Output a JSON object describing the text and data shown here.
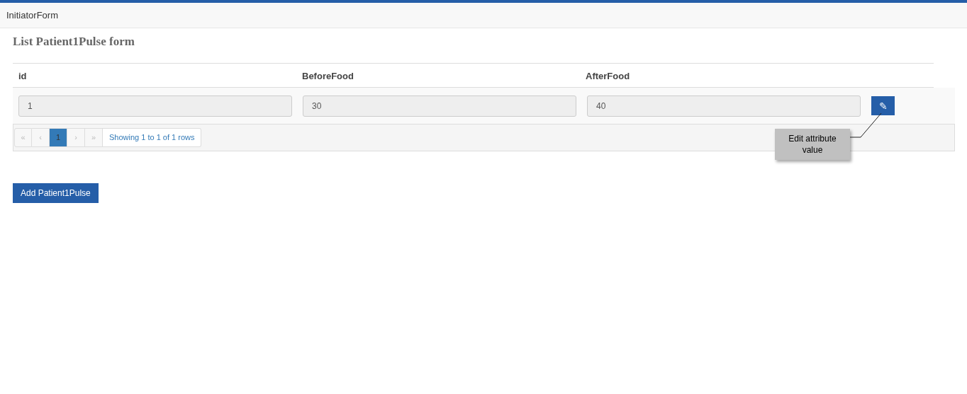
{
  "navbar": {
    "brand": "InitiatorForm"
  },
  "title": "List Patient1Pulse form",
  "table": {
    "columns": [
      "id",
      "BeforeFood",
      "AfterFood"
    ],
    "rows": [
      {
        "cells": [
          {
            "value": "1",
            "disabled": true
          },
          {
            "value": "30",
            "disabled": true
          },
          {
            "value": "40",
            "disabled": true
          }
        ],
        "edit_icon": "✎"
      }
    ]
  },
  "pagination": {
    "items": [
      {
        "label": "«",
        "disabled": true,
        "selected": false
      },
      {
        "label": "‹",
        "disabled": true,
        "selected": false
      },
      {
        "label": "1",
        "disabled": false,
        "selected": true
      },
      {
        "label": "›",
        "disabled": true,
        "selected": false
      },
      {
        "label": "»",
        "disabled": true,
        "selected": false
      }
    ],
    "summary": "Showing 1 to 1 of 1 rows"
  },
  "callout": "Edit attribute value",
  "add_button": "Add Patient1Pulse"
}
